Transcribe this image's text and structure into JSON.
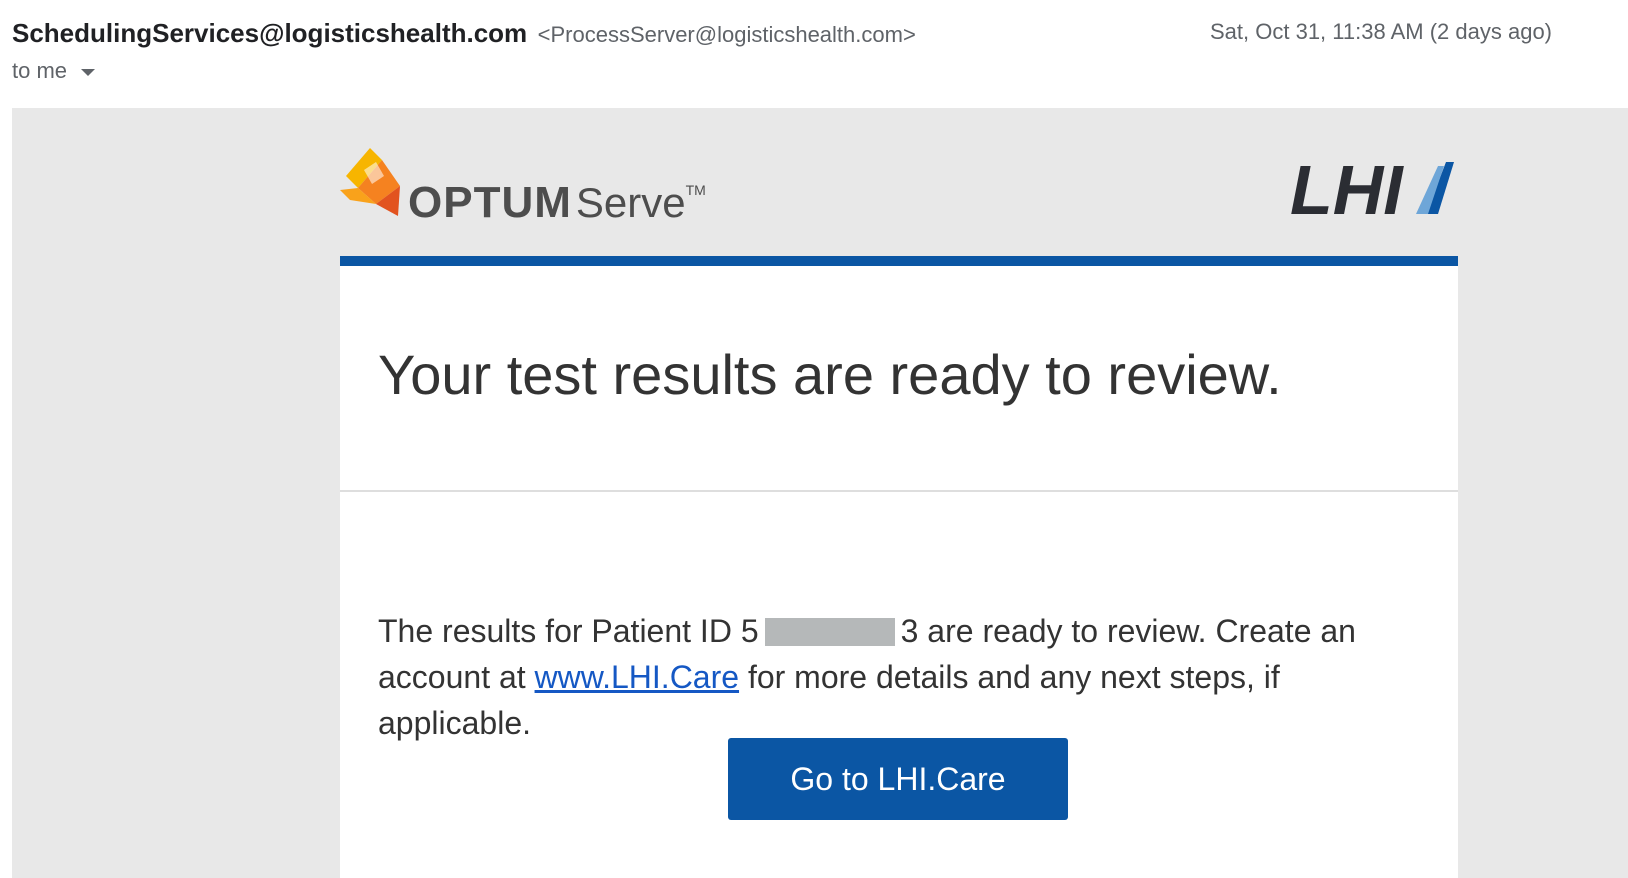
{
  "email": {
    "sender_name": "SchedulingServices@logisticshealth.com",
    "sender_address": "<ProcessServer@logisticshealth.com>",
    "date": "Sat, Oct 31, 11:38 AM (2 days ago)",
    "recipient": "to me"
  },
  "brands": {
    "optum_word": "OPTUM",
    "serve_word": "Serve",
    "tm": "TM",
    "lhi_logo_text": "LHI"
  },
  "content": {
    "headline": "Your test results are ready to review.",
    "body_part1": "The results for Patient ID ",
    "patient_id_first": "5",
    "patient_id_last": "3",
    "body_part2": " are ready to review. Create an account at ",
    "link_text": "www.LHI.Care",
    "body_part3": " for more details and any next steps, if applicable.",
    "button_label": "Go to LHI.Care"
  },
  "colors": {
    "brand_blue": "#0b56a4",
    "background_gray": "#e8e8e8",
    "link_blue": "#1558c4"
  }
}
